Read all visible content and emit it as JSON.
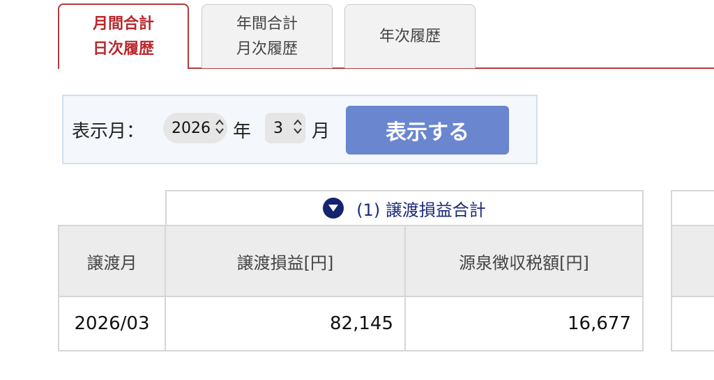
{
  "tabs": [
    {
      "line1": "月間合計",
      "line2": "日次履歴",
      "active": true
    },
    {
      "line1": "年間合計",
      "line2": "月次履歴",
      "active": false
    },
    {
      "line1": "年次履歴",
      "line2": "",
      "active": false
    }
  ],
  "filter": {
    "label": "表示月：",
    "year_value": "2026",
    "year_unit": "年",
    "month_value": "3",
    "month_unit": "月",
    "button_label": "表示する"
  },
  "table": {
    "group_header": "(1) 譲渡損益合計",
    "columns": [
      "譲渡月",
      "譲渡損益[円]",
      "源泉徴収税額[円]"
    ],
    "rows": [
      {
        "month": "2026/03",
        "gain": "82,145",
        "tax": "16,677"
      }
    ]
  },
  "colors": {
    "accent_red": "#b23a3a",
    "button_blue": "#6a86cf",
    "header_navy": "#14256d"
  }
}
